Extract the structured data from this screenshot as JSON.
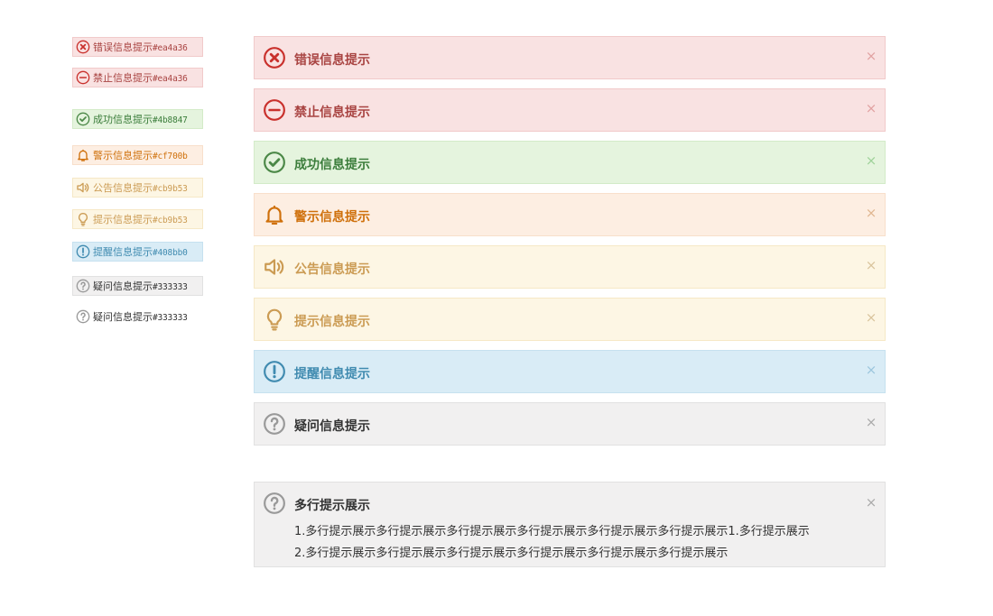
{
  "colors": {
    "error": {
      "text": "#a94442",
      "icon": "#c9302c",
      "bg": "#f9e2e2",
      "border": "#f1caca",
      "close": "#e1a2a2"
    },
    "forbidden": {
      "text": "#a94442",
      "icon": "#c9302c",
      "bg": "#f9e2e2",
      "border": "#f1caca",
      "close": "#e1a2a2"
    },
    "success": {
      "text": "#3b7d3b",
      "icon": "#4b8847",
      "bg": "#e5f4de",
      "border": "#d3ebc8",
      "close": "#9fd29a"
    },
    "warning": {
      "text": "#cf700b",
      "icon": "#cf700b",
      "bg": "#fdeee2",
      "border": "#f8dfcb",
      "close": "#e0b690"
    },
    "notice": {
      "text": "#cb9b53",
      "icon": "#cb9b53",
      "bg": "#fdf6e4",
      "border": "#f6e8c6",
      "close": "#d9c49d"
    },
    "tip": {
      "text": "#cb9b53",
      "icon": "#cb9b53",
      "bg": "#fdf6e4",
      "border": "#f6e8c6",
      "close": "#d9c49d"
    },
    "remind": {
      "text": "#408bb0",
      "icon": "#408bb0",
      "bg": "#d9ecf6",
      "border": "#c6e1ef",
      "close": "#9cc6dd"
    },
    "question": {
      "text": "#333333",
      "icon": "#999999",
      "bg": "#f1f0f0",
      "border": "#e1e1e1",
      "close": "#aaaaaa"
    }
  },
  "mini_badges": [
    {
      "type": "error",
      "icon": "x-circle-icon",
      "label": "错误信息提示",
      "hex": "#ea4a36"
    },
    {
      "type": "forbidden",
      "icon": "minus-circle-icon",
      "label": "禁止信息提示",
      "hex": "#ea4a36"
    },
    {
      "type": "success",
      "icon": "check-circle-icon",
      "label": "成功信息提示",
      "hex": "#4b8847"
    },
    {
      "type": "warning",
      "icon": "bell-icon",
      "label": "警示信息提示",
      "hex": "#cf700b"
    },
    {
      "type": "notice",
      "icon": "speaker-icon",
      "label": "公告信息提示",
      "hex": "#cb9b53"
    },
    {
      "type": "tip",
      "icon": "lightbulb-icon",
      "label": "提示信息提示",
      "hex": "#cb9b53"
    },
    {
      "type": "remind",
      "icon": "exclamation-circle-icon",
      "label": "提醒信息提示",
      "hex": "#408bb0"
    },
    {
      "type": "question",
      "icon": "question-circle-icon",
      "label": "疑问信息提示",
      "hex": "#333333"
    },
    {
      "type": "question-plain",
      "icon": "question-circle-icon",
      "label": "疑问信息提示",
      "hex": "#333333"
    }
  ],
  "alerts": [
    {
      "type": "error",
      "icon": "x-circle-icon",
      "title": "错误信息提示",
      "close": "×"
    },
    {
      "type": "forbidden",
      "icon": "minus-circle-icon",
      "title": "禁止信息提示",
      "close": "×"
    },
    {
      "type": "success",
      "icon": "check-circle-icon",
      "title": "成功信息提示",
      "close": "×"
    },
    {
      "type": "warning",
      "icon": "bell-icon",
      "title": "警示信息提示",
      "close": "×"
    },
    {
      "type": "notice",
      "icon": "speaker-icon",
      "title": "公告信息提示",
      "close": "×"
    },
    {
      "type": "tip",
      "icon": "lightbulb-icon",
      "title": "提示信息提示",
      "close": "×"
    },
    {
      "type": "remind",
      "icon": "exclamation-circle-icon",
      "title": "提醒信息提示",
      "close": "×"
    },
    {
      "type": "question",
      "icon": "question-circle-icon",
      "title": "疑问信息提示",
      "close": "×"
    }
  ],
  "multiline": {
    "type": "question",
    "icon": "question-circle-icon",
    "title": "多行提示展示",
    "close": "×",
    "lines": [
      "1.多行提示展示多行提示展示多行提示展示多行提示展示多行提示展示多行提示展示1.多行提示展示",
      "2.多行提示展示多行提示展示多行提示展示多行提示展示多行提示展示多行提示展示"
    ]
  }
}
